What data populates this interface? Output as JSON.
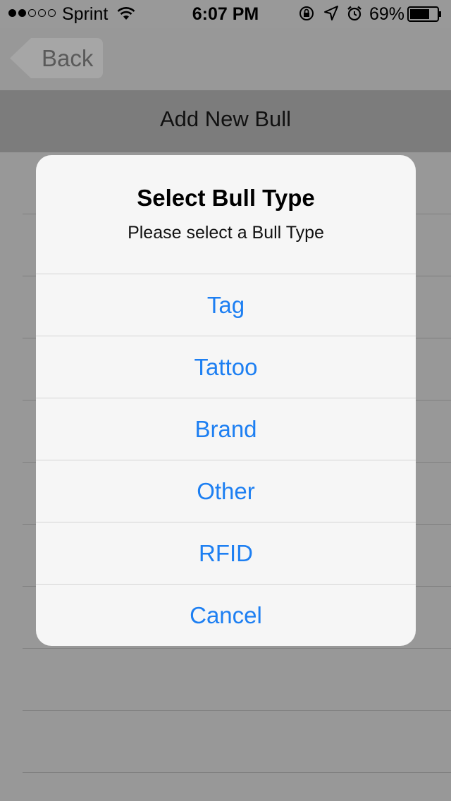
{
  "status_bar": {
    "carrier": "Sprint",
    "time": "6:07 PM",
    "battery": "69%",
    "signal_bars_filled": 2,
    "signal_bars_total": 5
  },
  "nav": {
    "back_label": "Back",
    "title": "Add New Bull"
  },
  "alert": {
    "title": "Select Bull Type",
    "message": "Please select a Bull Type",
    "actions": [
      {
        "label": "Tag"
      },
      {
        "label": "Tattoo"
      },
      {
        "label": "Brand"
      },
      {
        "label": "Other"
      },
      {
        "label": "RFID"
      },
      {
        "label": "Cancel"
      }
    ]
  },
  "colors": {
    "action_blue": "#1d7ff2",
    "dim_background": "#999999",
    "alert_background": "#f6f6f6"
  }
}
